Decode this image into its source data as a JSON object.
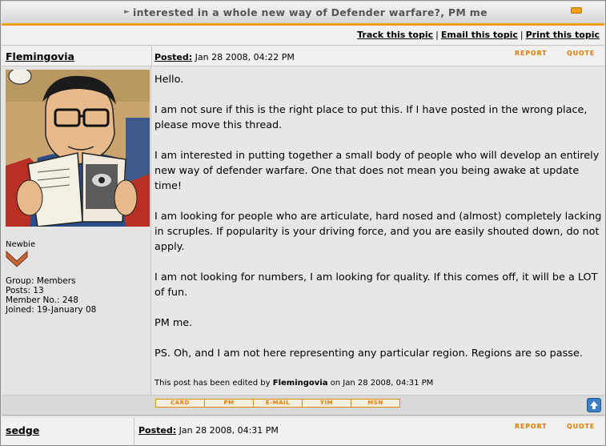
{
  "topic": {
    "title": "interested in a whole new way of Defender warfare?, PM me"
  },
  "actions": {
    "track": "Track this topic",
    "email": "Email this topic",
    "print": "Print this topic",
    "sep": "|"
  },
  "post1": {
    "author": "Flemingovia",
    "posted_label": "Posted:",
    "posted_date": "Jan 28 2008, 04:22 PM",
    "report": "REPORT",
    "quote": "QUOTE",
    "rank": "Newbie",
    "group": "Group: Members",
    "posts": "Posts: 13",
    "member_no": "Member No.: 248",
    "joined": "Joined: 19-January 08",
    "paragraphs": [
      "Hello.",
      "I am not sure if this is the right place to put this. If I have posted in the wrong place, please move this thread.",
      "I am interested in putting together a small body of people who will develop an entirely new way of defender warfare. One that does not mean you being awake at update time!",
      "I am looking for people who are articulate, hard nosed and (almost) completely lacking in scruples. If popularity is your driving force, and you are easily shouted down, do not apply.",
      "I am not looking for numbers, I am looking for quality. If this comes off, it will be a LOT of fun.",
      "PM me.",
      "PS. Oh, and I am not here representing any particular region. Regions are so passe."
    ],
    "edited_prefix": "This post has been edited by",
    "edited_by": "Flemingovia",
    "edited_suffix": "on Jan 28 2008, 04:31 PM",
    "buttons": [
      "CARD",
      "PM",
      "E-MAIL",
      "YIM",
      "MSN"
    ]
  },
  "post2": {
    "author": "sedge",
    "posted_label": "Posted:",
    "posted_date": "Jan 28 2008, 04:31 PM",
    "report": "REPORT",
    "quote": "QUOTE"
  }
}
